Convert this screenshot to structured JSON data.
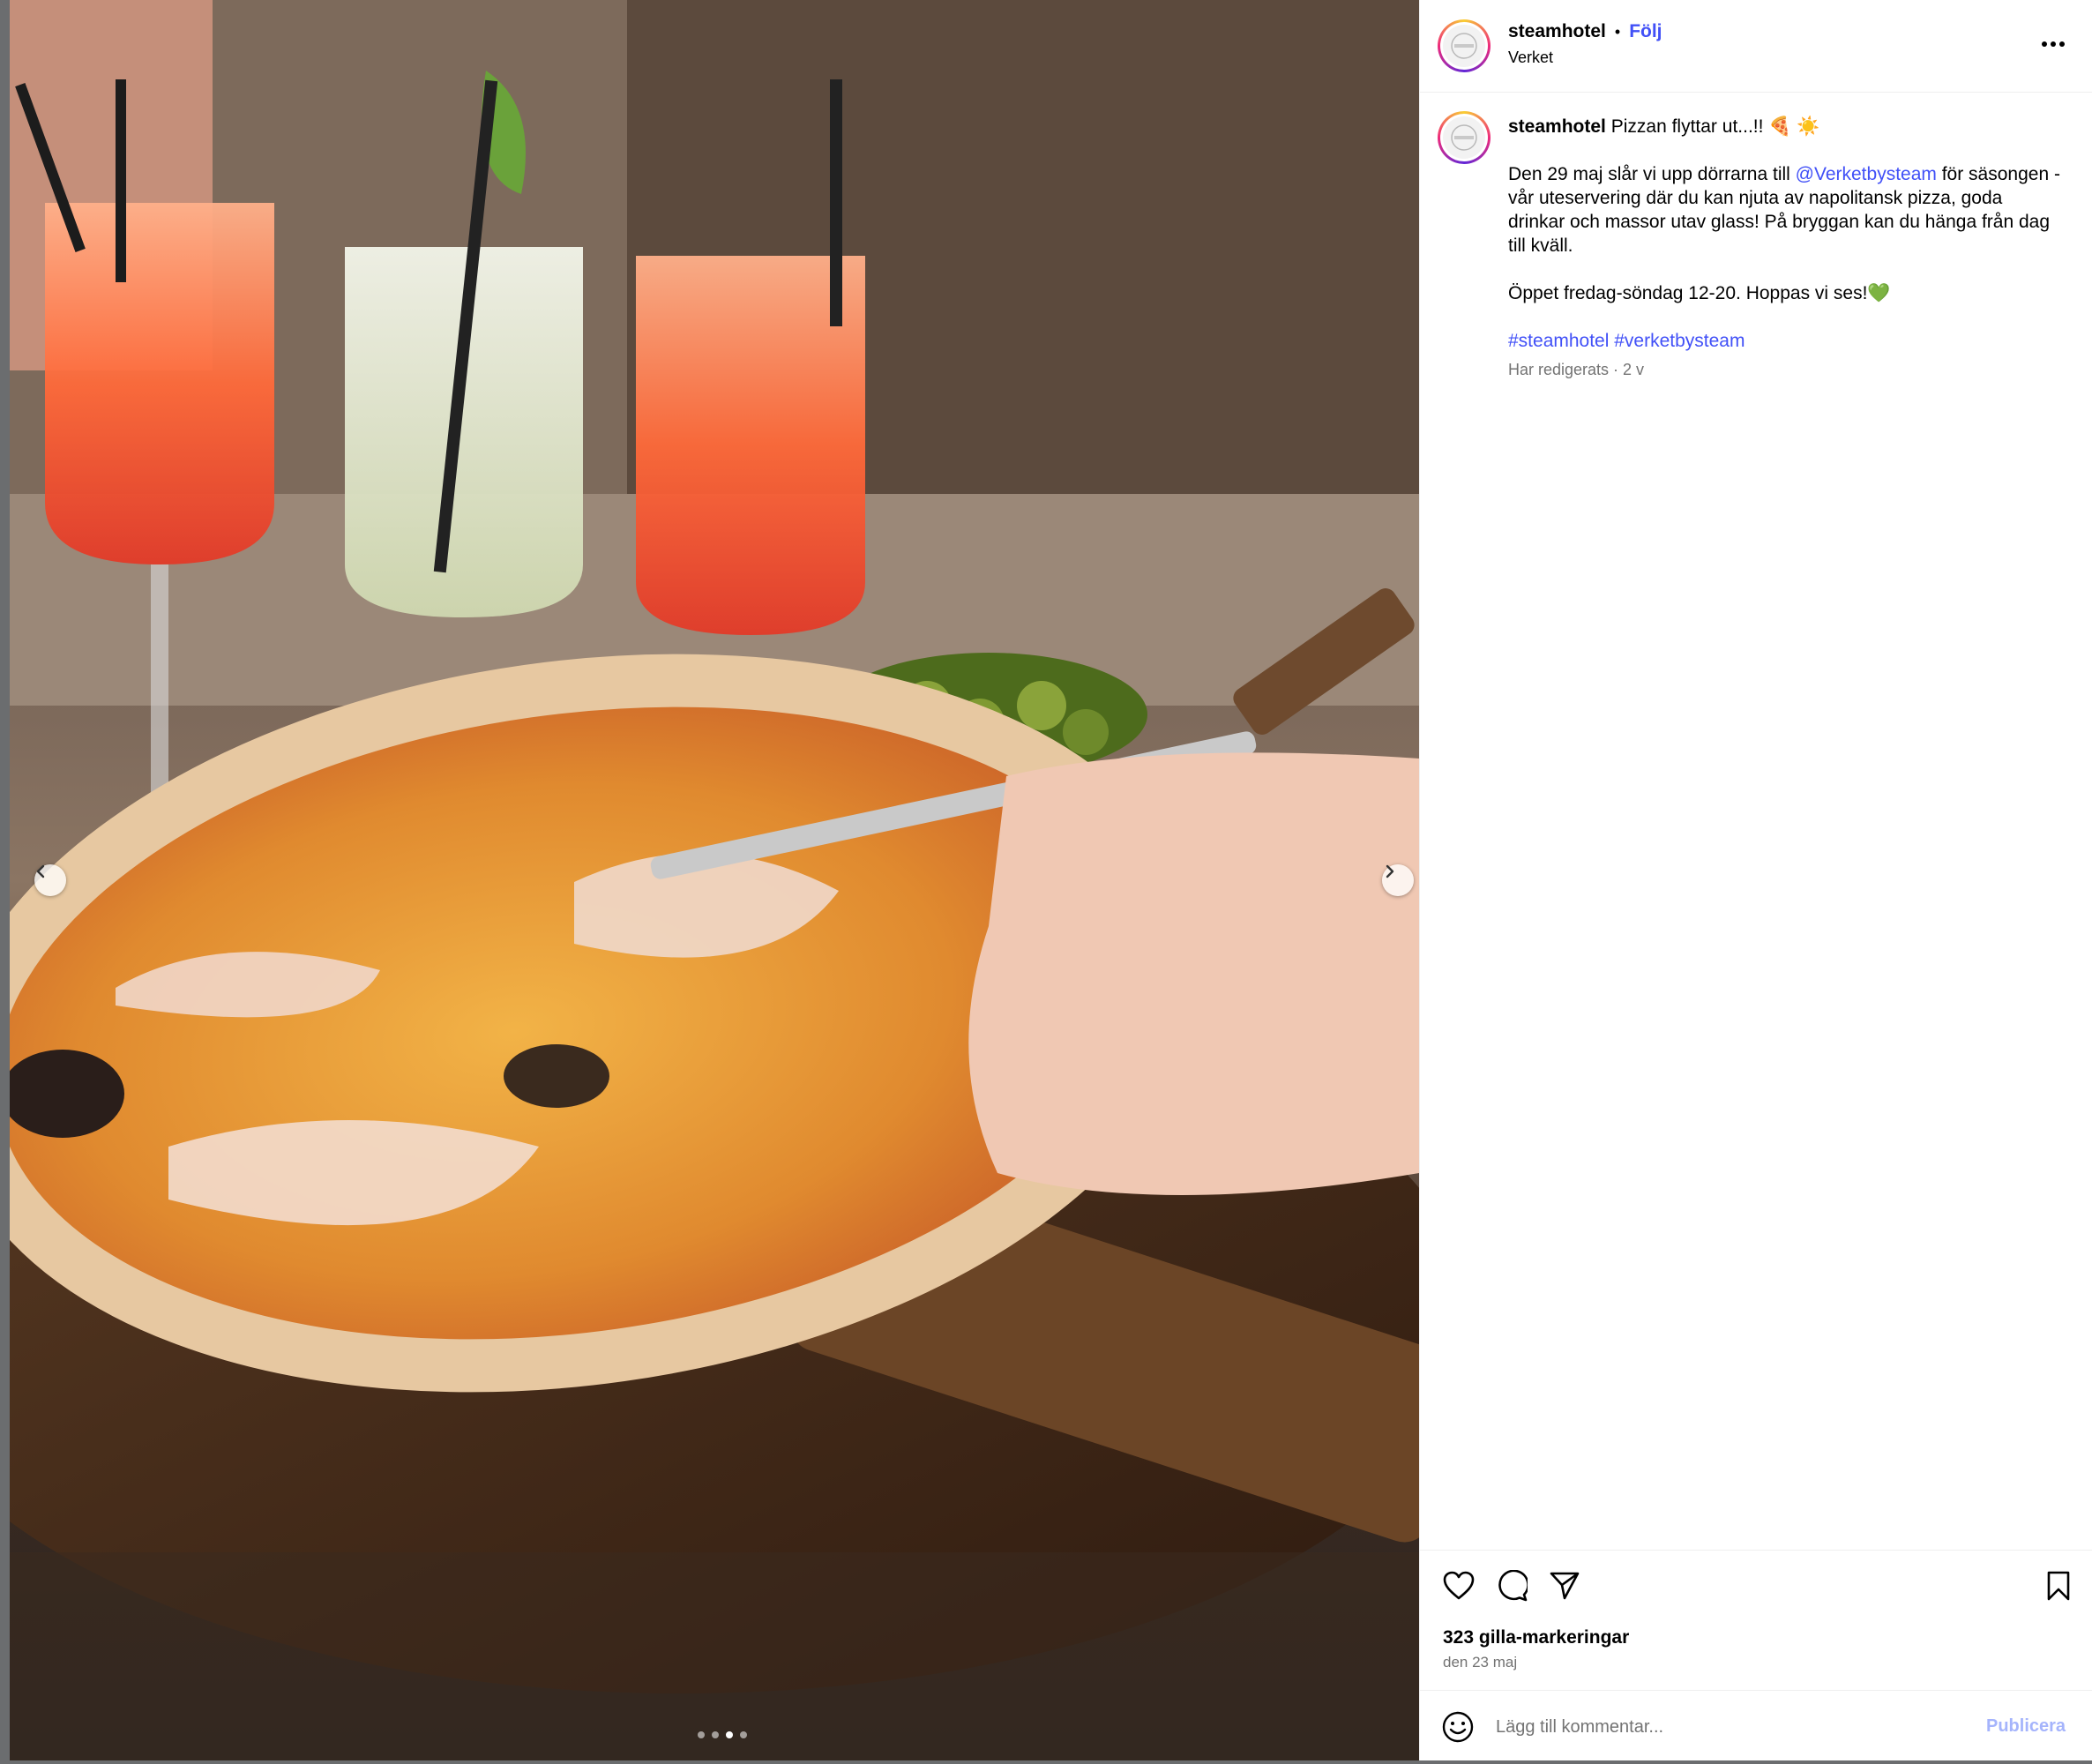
{
  "header": {
    "username": "steamhotel",
    "separator": "•",
    "follow_label": "Följ",
    "location": "Verket"
  },
  "caption": {
    "username": "steamhotel",
    "title_text": "Pizzan flyttar ut...!!",
    "title_emoji": "🍕 ☀️",
    "para1_before": "Den 29 maj slår vi upp dörrarna till ",
    "para1_mention": "@Verketbysteam",
    "para1_after": " för säsongen - vår uteservering där du kan njuta av napolitansk pizza, goda drinkar och massor utav glass! På bryggan kan du hänga från dag till kväll.",
    "para2": "Öppet fredag-söndag 12-20. Hoppas vi ses!",
    "para2_emoji": "💚",
    "hashtag1": "#steamhotel",
    "hashtag2": "#verketbysteam",
    "edited": "Har redigerats",
    "meta_sep": " · ",
    "age": "2 v"
  },
  "actions": {
    "likes": "323 gilla-markeringar",
    "date": "den 23 maj"
  },
  "comment": {
    "placeholder": "Lägg till kommentar...",
    "publish_label": "Publicera"
  },
  "carousel": {
    "slide_count": 4,
    "active_index": 2
  },
  "icons": {
    "like": "heart-icon",
    "comment": "comment-icon",
    "share": "paper-plane-icon",
    "save": "bookmark-icon",
    "emoji": "smiley-icon",
    "more": "more-dots-icon"
  },
  "colors": {
    "link": "#4150f7",
    "muted": "#737373",
    "publish_disabled": "#a5b4fc"
  }
}
